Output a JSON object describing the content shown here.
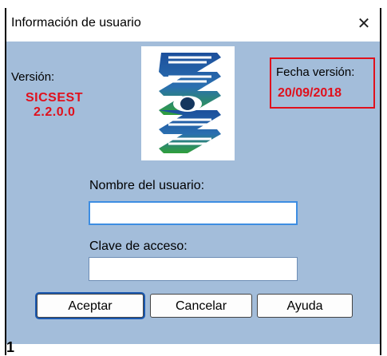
{
  "window": {
    "title": "Información de usuario",
    "close_icon": "close-icon"
  },
  "version": {
    "label": "Versión:",
    "name": "SICSEST",
    "number": "2.2.0.0"
  },
  "date": {
    "label": "Fecha versión:",
    "value": "20/09/2018"
  },
  "form": {
    "username_label": "Nombre del usuario:",
    "username_value": "",
    "password_label": "Clave de acceso:",
    "password_value": ""
  },
  "buttons": {
    "accept": "Aceptar",
    "cancel": "Cancelar",
    "help": "Ayuda"
  },
  "footer": {
    "page_number": "1"
  },
  "colors": {
    "client_bg": "#a3bdda",
    "accent_red": "#e0101c",
    "logo_blue": "#1c4f9c",
    "logo_green": "#2f9f3a"
  }
}
